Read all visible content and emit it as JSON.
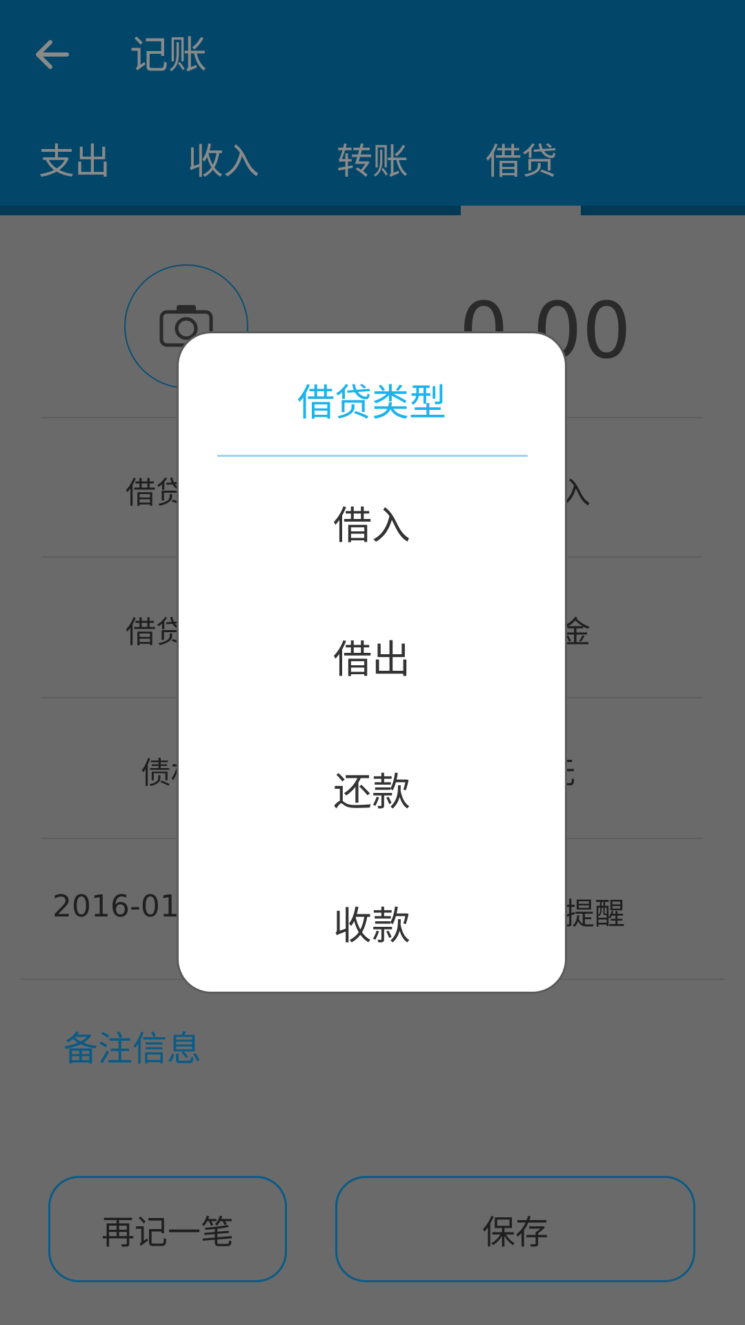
{
  "header": {
    "title": "记账"
  },
  "tabs": [
    {
      "label": "支出"
    },
    {
      "label": "收入"
    },
    {
      "label": "转账"
    },
    {
      "label": "借贷",
      "selected": true
    }
  ],
  "form": {
    "amount": "0.00",
    "rows": [
      {
        "label_left": "借贷",
        "label_right": "入"
      },
      {
        "label_left": "借贷",
        "label_right": "金"
      },
      {
        "label_left": "债权",
        "label_right": "无"
      },
      {
        "label_left": "2016-01",
        "label_right": "提醒"
      }
    ],
    "notes_label": "备注信息"
  },
  "buttons": {
    "again_label": "再记一笔",
    "save_label": "保存"
  },
  "dialog": {
    "title": "借贷类型",
    "options": [
      {
        "label": "借入"
      },
      {
        "label": "借出"
      },
      {
        "label": "还款"
      },
      {
        "label": "收款"
      }
    ]
  },
  "colors": {
    "appbar": "#02476a",
    "accent": "#1ab3ec",
    "overlay_background": "#6a6a6a"
  },
  "icons": {
    "back": "arrow-left-icon",
    "camera": "camera-icon"
  }
}
